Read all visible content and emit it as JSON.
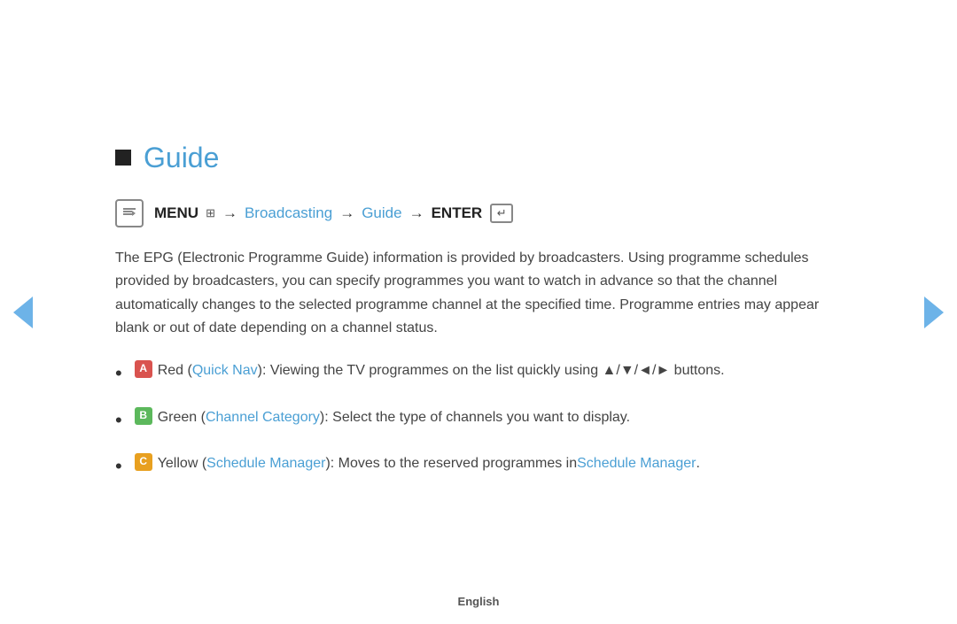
{
  "title": {
    "label": "Guide"
  },
  "menu_nav": {
    "menu_label": "MENU",
    "arrow": "→",
    "broadcasting": "Broadcasting",
    "guide": "Guide",
    "enter": "ENTER"
  },
  "body_text": "The EPG (Electronic Programme Guide) information is provided by broadcasters. Using programme schedules provided by broadcasters, you can specify programmes you want to watch in advance so that the channel automatically changes to the selected programme channel at the specified time. Programme entries may appear blank or out of date depending on a channel status.",
  "bullets": [
    {
      "badge": "A",
      "badge_class": "badge-red",
      "color_name": "Red",
      "link_text": "Quick Nav",
      "description": ": Viewing the TV programmes on the list quickly using ▲/▼/◄/► buttons."
    },
    {
      "badge": "B",
      "badge_class": "badge-green",
      "color_name": "Green",
      "link_text": "Channel Category",
      "description": ": Select the type of channels you want to display."
    },
    {
      "badge": "C",
      "badge_class": "badge-yellow",
      "color_name": "Yellow",
      "link_text": "Schedule Manager",
      "description": ": Moves to the reserved programmes in",
      "extra_link": "Schedule Manager",
      "extra_suffix": "."
    }
  ],
  "footer": {
    "language": "English"
  },
  "nav": {
    "left_label": "previous page",
    "right_label": "next page"
  }
}
